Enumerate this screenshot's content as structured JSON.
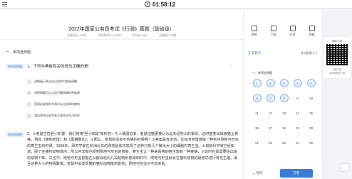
{
  "timer": {
    "value": "01:58:12"
  },
  "paper": {
    "title": "2022年国家公务员考试《行测》真题（副省级）",
    "meta": [
      "试卷总分:135分",
      "考试时间:120分钟",
      "平均分:81分",
      "总题量:134题"
    ]
  },
  "section": {
    "title": "一、单项选择题"
  },
  "q1": {
    "tag": "单项选择题",
    "text": "1、下列与典故有关的说法正确的是:",
    "options": [
      {
        "letter": "A",
        "text": "讲解展示多自出以前的为地质调整"
      },
      {
        "letter": "B",
        "text": "讲授揭露可以让初已醒准确的原暗规"
      },
      {
        "letter": "C",
        "text": "西周说说指外中海可以过双明的朗刺"
      },
      {
        "letter": "D",
        "text": "我自然合议因空表大量技长时乃球发"
      }
    ]
  },
  "q2": {
    "tag": "单项选择题",
    "text": "2、①老鼠生性胆小机警，我们常用“胆小如鼠”来形容一个人懦弱怕事，老鼠怕猫更被认为是天经地义的事情，这时猫变出辉被猫上狮裤，例如《猫和老鼠》和《黑猫警长》。②那么，老鼠有没有不怕猫的时候呢？③答案是肯定的。比如当老鼠感染一种名叫刚地弓形虫的寄生虫的时候。1908年，研究学家在非洲北非的刚地鼠体内发现了这种只有几个微米大小的细胞内寄生虫。④目前科学家已经知道，除了在猫科动物体内，所以并非有也受到刚地弓形虫的感染，寄生虫让一种病毒带的宿主患有一种疾病，⑤这时也是需要给出由的动物个体。只当中，刚地弓形虫鼠能在从都会经历几段动物肝部染和时中，刚地弓形虫就会在猫科动物的肠道内进行有性生殖。而且这种大小的特殊繁殖。老鼠中会发现猫的猫科动物能的影响，刚地弓形虫对不动关系。"
  },
  "side": {
    "tools": [
      {
        "icon": "pencil-icon",
        "label": "草稿"
      },
      {
        "icon": "download-icon",
        "label": "下载"
      },
      {
        "icon": "copy-icon",
        "label": "纠错"
      },
      {
        "icon": "star-icon",
        "label": "收藏"
      }
    ],
    "card_title": "答题卡",
    "card_mode": "非试题看卡 ▾",
    "section_label": "一、单项选择题",
    "numbers": [
      "1",
      "2",
      "3",
      "4",
      "5",
      "6",
      "7",
      "8",
      "9",
      "10",
      "11",
      "12",
      "13",
      "14",
      "15",
      "16",
      "17",
      "18",
      "19",
      "20",
      "21",
      "22",
      "23",
      "24",
      "25"
    ],
    "answered_count": 8,
    "pause_label": "暂停",
    "submit_label": "交卷"
  },
  "qr": {
    "title": "题库下载",
    "sub1": "扫码下载",
    "sub2": "手机刷题更方便"
  }
}
